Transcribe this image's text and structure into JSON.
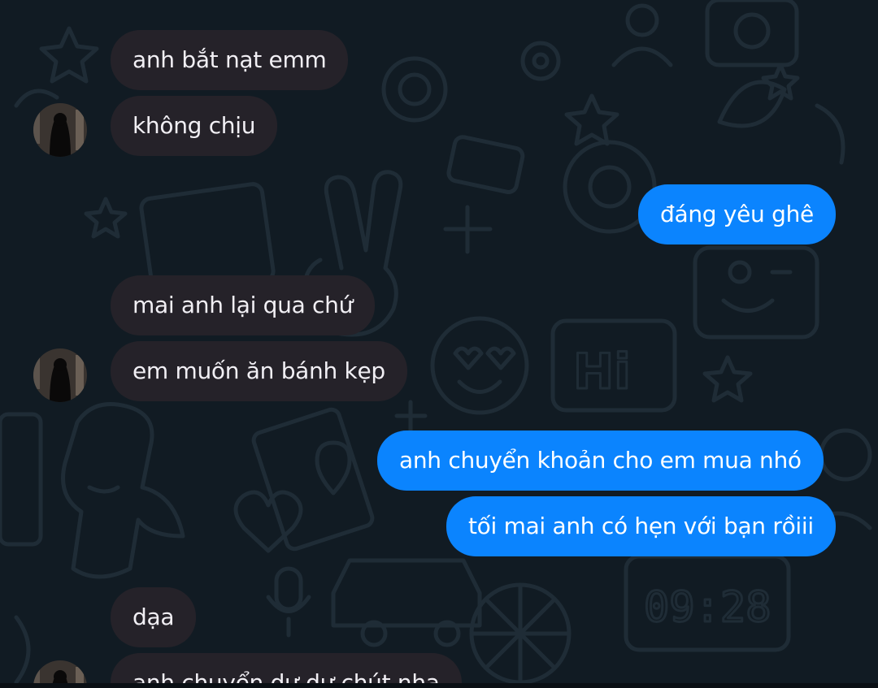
{
  "conversation": {
    "messages": [
      {
        "direction": "incoming",
        "text": "anh bắt nạt emm"
      },
      {
        "direction": "incoming",
        "text": "không chịu"
      },
      {
        "direction": "outgoing",
        "text": "đáng yêu ghê"
      },
      {
        "direction": "incoming",
        "text": "mai anh lại qua chứ"
      },
      {
        "direction": "incoming",
        "text": "em muốn ăn bánh kẹp"
      },
      {
        "direction": "outgoing",
        "text": "anh chuyển khoản cho em mua nhó"
      },
      {
        "direction": "outgoing",
        "text": "tối mai anh có hẹn với bạn rồiii"
      },
      {
        "direction": "incoming",
        "text": "dạa"
      },
      {
        "direction": "incoming",
        "text": "anh chuyển dư dư chút nha"
      }
    ]
  },
  "wallpaper": {
    "doodle_text": "Hi",
    "clock_text": "09:28"
  },
  "colors": {
    "background": "#111b23",
    "incoming_bubble": "#252229",
    "outgoing_bubble": "#0b84fe",
    "text_light": "#f1eff4",
    "doodle_stroke": "#1f2c36"
  }
}
